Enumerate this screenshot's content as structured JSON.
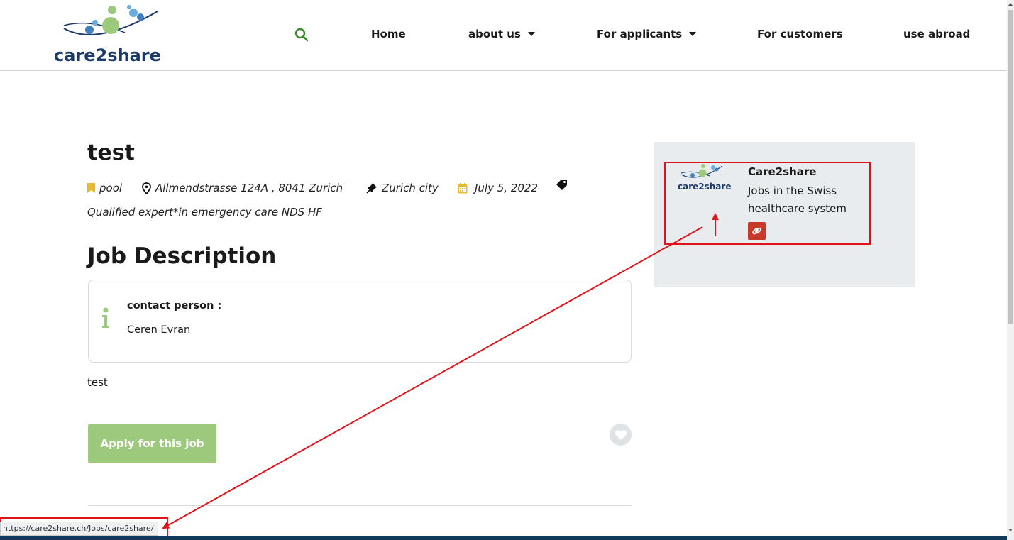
{
  "header": {
    "logo_text": "care2share",
    "nav": [
      {
        "label": "Home",
        "dropdown": false
      },
      {
        "label": "about us",
        "dropdown": true
      },
      {
        "label": "For applicants",
        "dropdown": true
      },
      {
        "label": "For customers",
        "dropdown": false
      },
      {
        "label": "use abroad",
        "dropdown": false
      }
    ]
  },
  "job": {
    "title": "test",
    "category": "pool",
    "address": "Allmendstrasse 124A , 8041 Zurich",
    "region": "Zurich city",
    "date": "July 5, 2022",
    "qualification": "Qualified expert*in emergency care NDS HF"
  },
  "description": {
    "heading": "Job Description",
    "contact_label": "contact person :",
    "contact_name": "Ceren Evran",
    "text": "test"
  },
  "actions": {
    "apply_label": "Apply for this job"
  },
  "company": {
    "logo_text": "care2share",
    "name": "Care2share",
    "tagline": "Jobs in the Swiss healthcare system"
  },
  "status_bar": {
    "url": "https://care2share.ch/Jobs/care2share/"
  },
  "colors": {
    "brand_navy": "#1b3a6b",
    "brand_green": "#9dc97c",
    "link_red": "#c8392b",
    "date_icon_yellow": "#e8b92a",
    "annotation_red": "#e0121a"
  }
}
